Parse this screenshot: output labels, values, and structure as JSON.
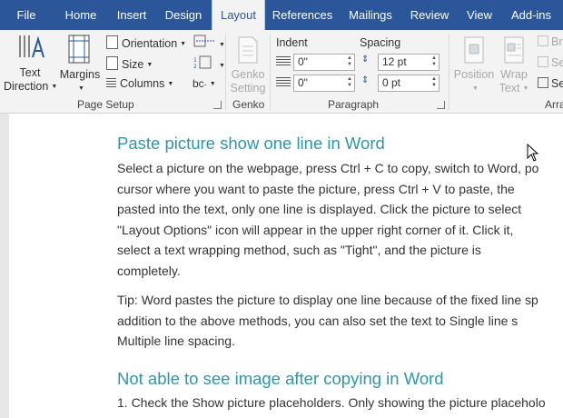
{
  "tabs": [
    "File",
    "Home",
    "Insert",
    "Design",
    "Layout",
    "References",
    "Mailings",
    "Review",
    "View",
    "Add-ins"
  ],
  "active_tab": "Layout",
  "ribbon": {
    "text_direction": [
      "Text",
      "Direction"
    ],
    "margins": "Margins",
    "orientation": "Orientation",
    "size": "Size",
    "columns": "Columns",
    "page_setup_label": "Page Setup",
    "genko_button": [
      "Genko",
      "Setting"
    ],
    "genko_label": "Genko",
    "indent_label": "Indent",
    "spacing_label": "Spacing",
    "indent_left": "0\"",
    "indent_right": "0\"",
    "spacing_before": "12 pt",
    "spacing_after": "0 pt",
    "paragraph_label": "Paragraph",
    "position": "Position",
    "wrap_text": [
      "Wrap",
      "Text"
    ],
    "arrange_label": "Arra",
    "bring_forward_partial": "Br",
    "send_backward_partial": "Se",
    "selection_partial": "Se"
  },
  "document": {
    "heading1": "Paste picture show one line in Word",
    "para1": [
      "Select a picture on the webpage, press Ctrl + C to copy, switch to Word, po",
      "cursor where you want to paste the picture, press Ctrl + V to paste, the",
      "pasted into the text, only one line is displayed. Click the picture to select",
      "\"Layout Options\" icon will appear in the upper right corner of it. Click it,",
      "select a text wrapping method, such as \"Tight\", and the picture is",
      "completely."
    ],
    "para2": [
      "Tip: Word pastes the picture to display one line because of the fixed line sp",
      "addition to the above methods, you can also set the text to Single line s",
      "Multiple line spacing."
    ],
    "heading2": "Not able to see image after copying in Word",
    "para3": [
      "1. Check the Show picture placeholders. Only showing the picture placeholo"
    ]
  }
}
